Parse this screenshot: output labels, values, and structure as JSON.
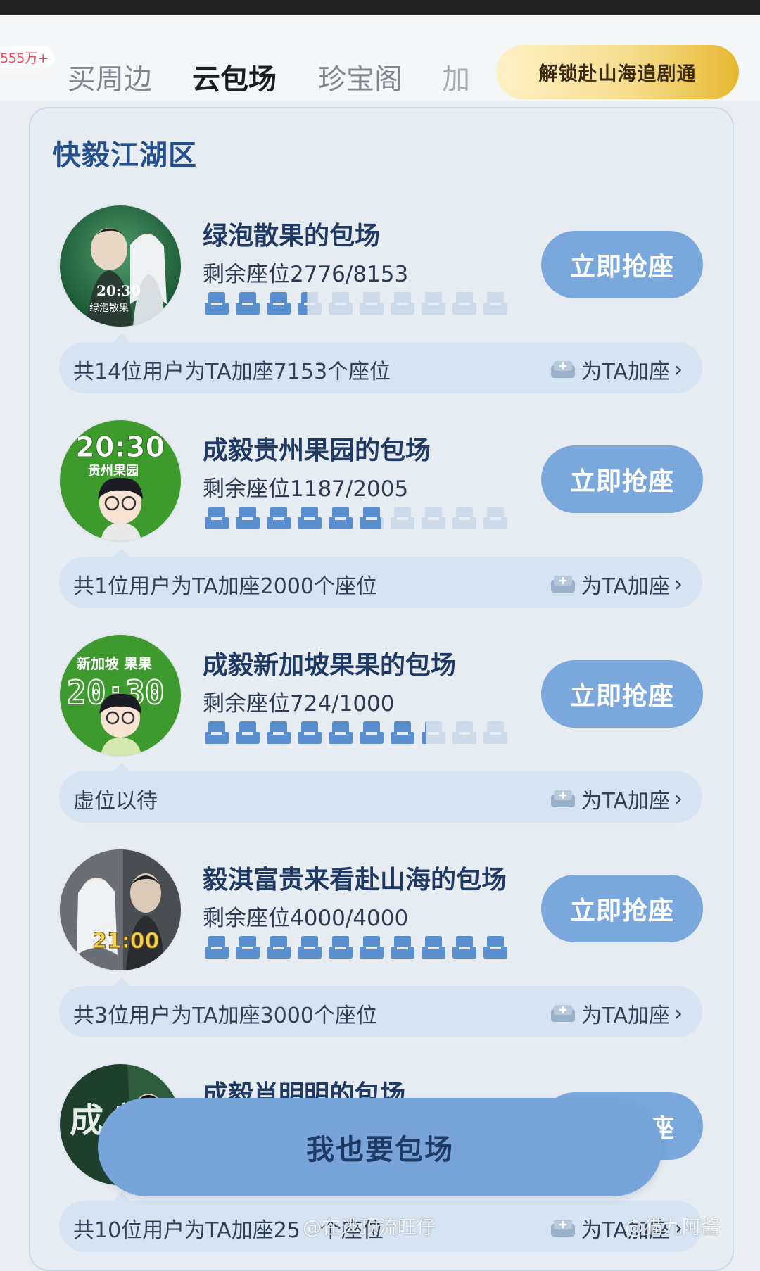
{
  "nav": {
    "views_badge": "555万+",
    "tabs": [
      {
        "label": "买周边",
        "active": false
      },
      {
        "label": "云包场",
        "active": true
      },
      {
        "label": "珍宝阁",
        "active": false
      },
      {
        "label": "加",
        "active": false
      }
    ],
    "unlock_button": "解锁赴山海追剧通"
  },
  "section": {
    "title": "快毅江湖区"
  },
  "colors": {
    "accent_blue": "#7aa8dc",
    "title_blue": "#24508e",
    "gold": "#e6b730",
    "seat_filled": "#5a8fcf",
    "seat_empty": "#ccdaea"
  },
  "cards": [
    {
      "name": "绿泡散果的包场",
      "remaining": "剩余座位2776/8153",
      "seats_fraction": 0.34,
      "grab_button": "立即抢座",
      "info_text": "共14位用户为TA加座7153个座位",
      "add_seat_label": "为TA加座",
      "avatar": {
        "time": "20:30",
        "caption": "绿泡散果"
      }
    },
    {
      "name": "成毅贵州果园的包场",
      "remaining": "剩余座位1187/2005",
      "seats_fraction": 0.59,
      "grab_button": "立即抢座",
      "info_text": "共1位用户为TA加座2000个座位",
      "add_seat_label": "为TA加座",
      "avatar": {
        "time": "20:30",
        "caption": "贵州果园"
      }
    },
    {
      "name": "成毅新加坡果果的包场",
      "remaining": "剩余座位724/1000",
      "seats_fraction": 0.72,
      "grab_button": "立即抢座",
      "info_text": "虚位以待",
      "add_seat_label": "为TA加座",
      "avatar": {
        "time": "20:30",
        "caption": "新加坡 果果"
      }
    },
    {
      "name": "毅淇富贵来看赴山海的包场",
      "remaining": "剩余座位4000/4000",
      "seats_fraction": 1.0,
      "grab_button": "立即抢座",
      "info_text": "共3位用户为TA加座3000个座位",
      "add_seat_label": "为TA加座",
      "avatar": {
        "time": "21:00"
      }
    },
    {
      "name": "成毅肖明明的包场",
      "grab_button": "座",
      "info_text": "共10位用户为TA加座25",
      "info_text_tail": "个座位",
      "add_seat_label": "为TA加座",
      "avatar": {
        "glyphs": "成 毅"
      }
    }
  ],
  "floating_button": "我也要包场",
  "watermarks": [
    "@在逃顶流旺仔",
    "@猫九阿酱"
  ]
}
